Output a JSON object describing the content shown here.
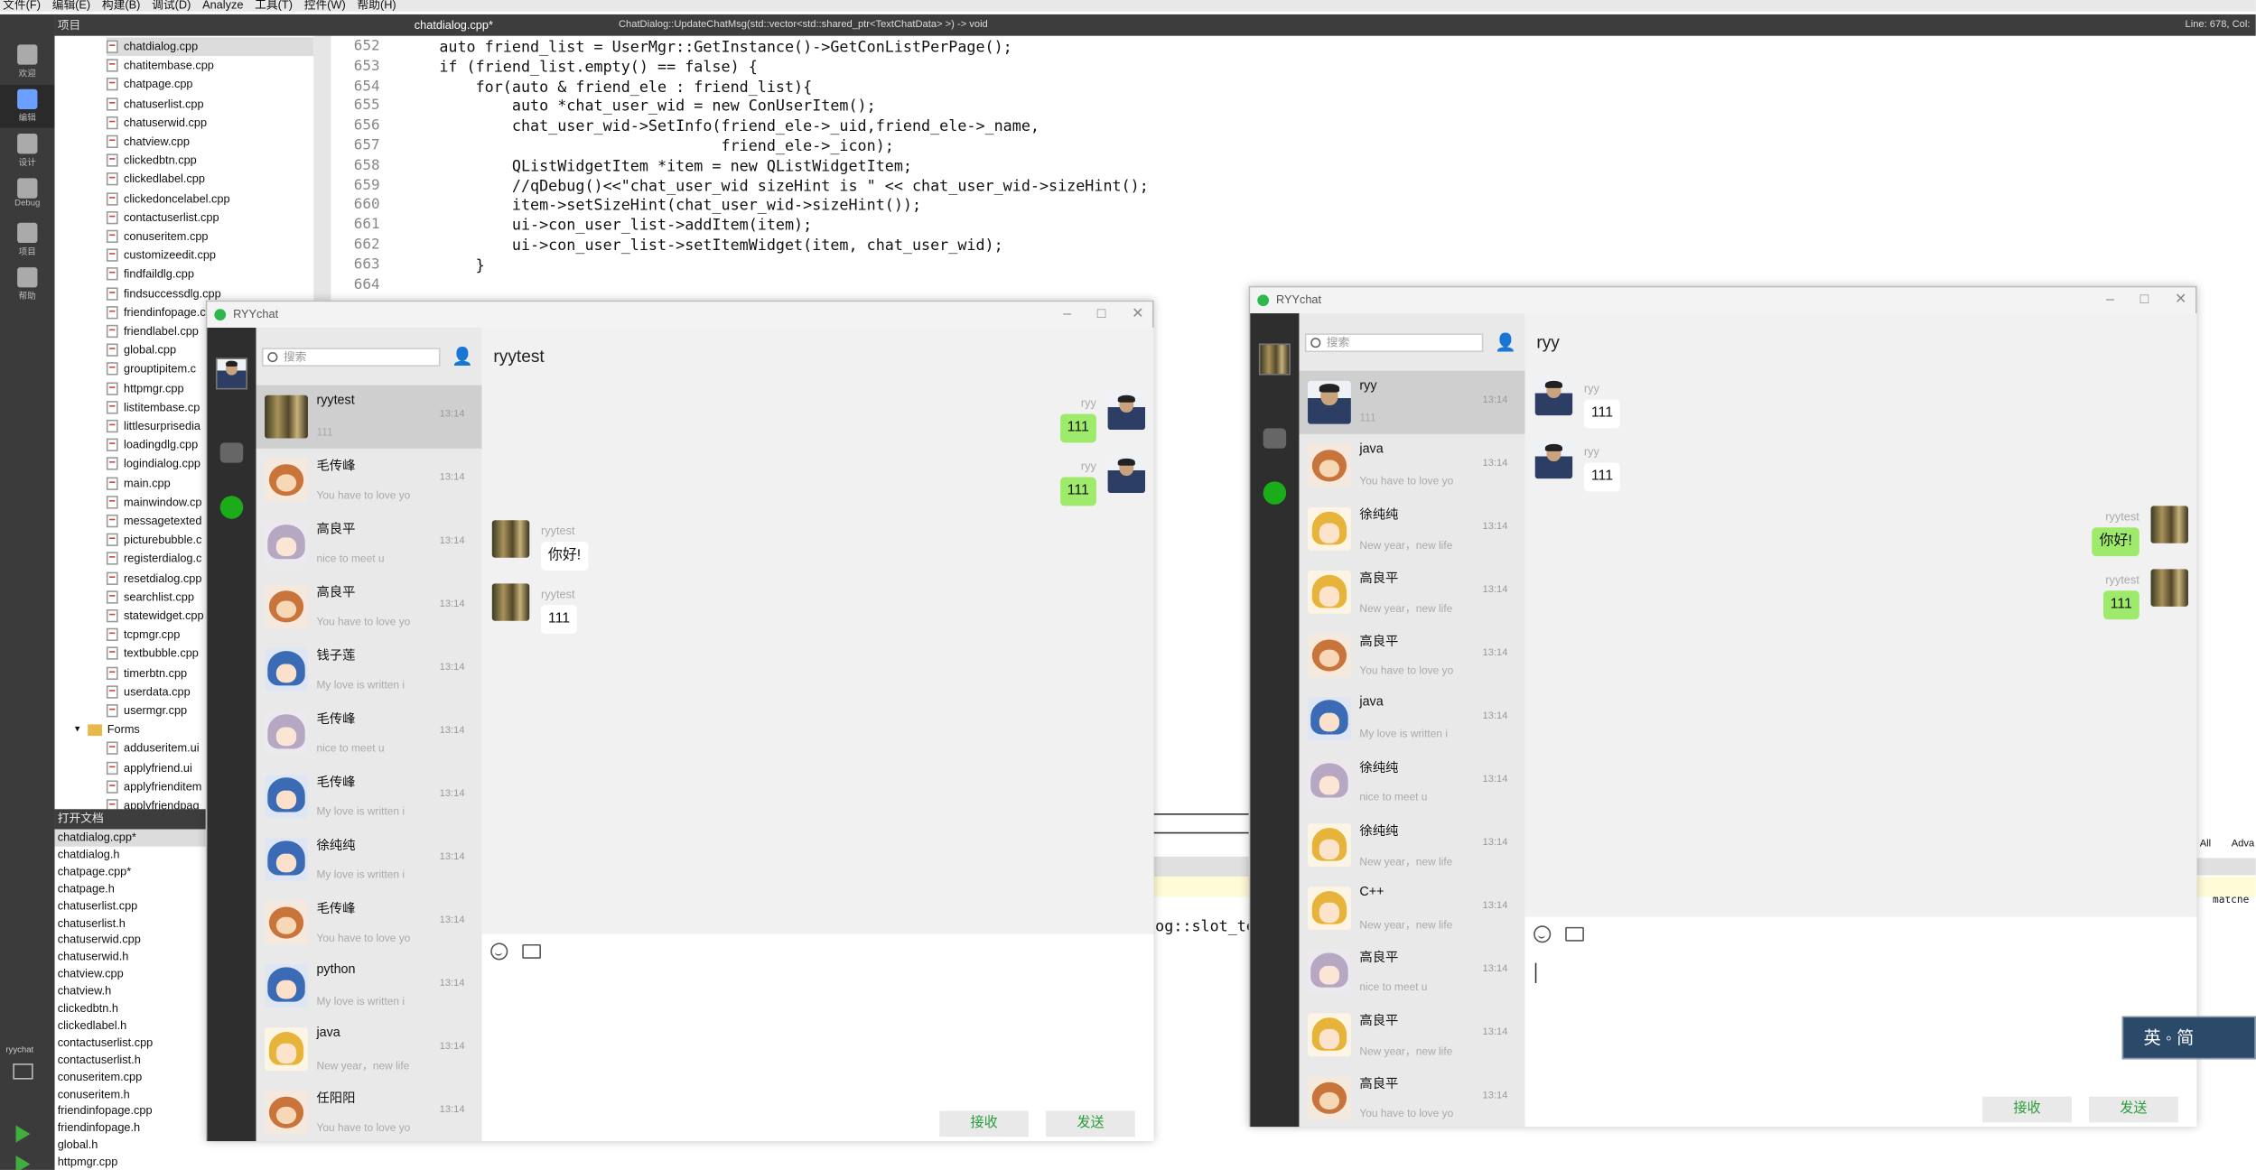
{
  "ide": {
    "menu": [
      "文件(F)",
      "编辑(E)",
      "构建(B)",
      "调试(D)",
      "Analyze",
      "工具(T)",
      "控件(W)",
      "帮助(H)"
    ],
    "project_label": "项目",
    "open_file": "chatdialog.cpp*",
    "function_sig": "ChatDialog::UpdateChatMsg(std::vector<std::shared_ptr<TextChatData> >) -> void",
    "line_info": "Line: 678, Col:",
    "modes": [
      "欢迎",
      "编辑",
      "设计",
      "Debug",
      "项目",
      "帮助"
    ],
    "tree_files": [
      "chatdialog.cpp",
      "chatitembase.cpp",
      "chatpage.cpp",
      "chatuserlist.cpp",
      "chatuserwid.cpp",
      "chatview.cpp",
      "clickedbtn.cpp",
      "clickedlabel.cpp",
      "clickedoncelabel.cpp",
      "contactuserlist.cpp",
      "conuseritem.cpp",
      "customizeedit.cpp",
      "findfaildlg.cpp",
      "findsuccessdlg.cpp",
      "friendinfopage.c",
      "friendlabel.cpp",
      "global.cpp",
      "grouptipitem.c",
      "httpmgr.cpp",
      "listitembase.cp",
      "littlesurprisedia",
      "loadingdlg.cpp",
      "logindialog.cpp",
      "main.cpp",
      "mainwindow.cp",
      "messagetexted",
      "picturebubble.c",
      "registerdialog.c",
      "resetdialog.cpp",
      "searchlist.cpp",
      "statewidget.cpp",
      "tcpmgr.cpp",
      "textbubble.cpp",
      "timerbtn.cpp",
      "userdata.cpp",
      "usermgr.cpp"
    ],
    "forms_label": "Forms",
    "form_files": [
      "adduseritem.ui",
      "applyfriend.ui",
      "applyfrienditem",
      "applyfriendpag"
    ],
    "open_docs_label": "打开文档",
    "open_docs": [
      "chatdialog.cpp*",
      "chatdialog.h",
      "chatpage.cpp*",
      "chatpage.h",
      "chatuserlist.cpp",
      "chatuserlist.h",
      "chatuserwid.cpp",
      "chatuserwid.h",
      "chatview.cpp",
      "chatview.h",
      "clickedbtn.h",
      "clickedlabel.h",
      "contactuserlist.cpp",
      "contactuserlist.h",
      "conuseritem.cpp",
      "conuseritem.h",
      "friendinfopage.cpp",
      "friendinfopage.h",
      "global.h",
      "httpmgr.cpp"
    ],
    "line_numbers": [
      "652",
      "653",
      "654",
      "655",
      "656",
      "657",
      "658",
      "659",
      "660",
      "661",
      "662",
      "663",
      "664"
    ],
    "code_lines": [
      "    auto friend_list = UserMgr::GetInstance()->GetConListPerPage();",
      "    if (friend_list.empty() == false) {",
      "        for(auto & friend_ele : friend_list){",
      "            auto *chat_user_wid = new ConUserItem();",
      "            chat_user_wid->SetInfo(friend_ele->_uid,friend_ele->_name,",
      "                                   friend_ele->_icon);",
      "            QListWidgetItem *item = new QListWidgetItem;",
      "            //qDebug()<<\"chat_user_wid sizeHint is \" << chat_user_wid->sizeHint();",
      "            item->setSizeHint(chat_user_wid->sizeHint());",
      "            ui->con_user_list->addItem(item);",
      "            ui->con_user_list->setItemWidget(item, chat_user_wid);",
      "        }",
      ""
    ],
    "partial_code": "og::slot_te",
    "right_stub_1": "All",
    "right_stub_2": "Adva",
    "right_stub_3": "3 matche",
    "target_label": "ryychat",
    "ime": "英 ◦ 简"
  },
  "win_left": {
    "title": "RYYchat",
    "search_placeholder": "搜索",
    "chat_title": "ryytest",
    "items": [
      {
        "name": "ryytest",
        "preview": "111",
        "time": "13:14",
        "av": "av-shelf"
      },
      {
        "name": "毛传峰",
        "preview": "You have to love yo",
        "time": "13:14",
        "av": "av-bear"
      },
      {
        "name": "高良平",
        "preview": "nice to meet u",
        "time": "13:14",
        "av": "av-gray"
      },
      {
        "name": "高良平",
        "preview": "You have to love yo",
        "time": "13:14",
        "av": "av-bear"
      },
      {
        "name": "钱子莲",
        "preview": "My love is written i",
        "time": "13:14",
        "av": "av-girl"
      },
      {
        "name": "毛传峰",
        "preview": "nice to meet u",
        "time": "13:14",
        "av": "av-gray"
      },
      {
        "name": "毛传峰",
        "preview": "My love is written i",
        "time": "13:14",
        "av": "av-girl"
      },
      {
        "name": "徐纯纯",
        "preview": "My love is written i",
        "time": "13:14",
        "av": "av-girl"
      },
      {
        "name": "毛传峰",
        "preview": "You have to love yo",
        "time": "13:14",
        "av": "av-bear"
      },
      {
        "name": "python",
        "preview": "My love is written i",
        "time": "13:14",
        "av": "av-girl"
      },
      {
        "name": "java",
        "preview": "New year，new life",
        "time": "13:14",
        "av": "av-crown"
      },
      {
        "name": "任阳阳",
        "preview": "You have to love yo",
        "time": "13:14",
        "av": "av-bear"
      }
    ],
    "messages": [
      {
        "side": "mine",
        "who": "ryy",
        "text": "111",
        "av": "av-photo"
      },
      {
        "side": "mine",
        "who": "ryy",
        "text": "111",
        "av": "av-photo"
      },
      {
        "side": "other",
        "who": "ryytest",
        "text": "你好!",
        "av": "av-shelf"
      },
      {
        "side": "other",
        "who": "ryytest",
        "text": "111",
        "av": "av-shelf"
      }
    ],
    "btn_receive": "接收",
    "btn_send": "发送"
  },
  "win_right": {
    "title": "RYYchat",
    "search_placeholder": "搜索",
    "chat_title": "ryy",
    "items": [
      {
        "name": "ryy",
        "preview": "111",
        "time": "13:14",
        "av": "av-photo"
      },
      {
        "name": "java",
        "preview": "You have to love yo",
        "time": "13:14",
        "av": "av-bear"
      },
      {
        "name": "徐纯纯",
        "preview": "New year，new life",
        "time": "13:14",
        "av": "av-crown"
      },
      {
        "name": "高良平",
        "preview": "New year，new life",
        "time": "13:14",
        "av": "av-crown"
      },
      {
        "name": "高良平",
        "preview": "You have to love yo",
        "time": "13:14",
        "av": "av-bear"
      },
      {
        "name": "java",
        "preview": "My love is written i",
        "time": "13:14",
        "av": "av-girl"
      },
      {
        "name": "徐纯纯",
        "preview": "nice to meet u",
        "time": "13:14",
        "av": "av-gray"
      },
      {
        "name": "徐纯纯",
        "preview": "New year，new life",
        "time": "13:14",
        "av": "av-crown"
      },
      {
        "name": "C++",
        "preview": "New year，new life",
        "time": "13:14",
        "av": "av-crown"
      },
      {
        "name": "高良平",
        "preview": "nice to meet u",
        "time": "13:14",
        "av": "av-gray"
      },
      {
        "name": "高良平",
        "preview": "New year，new life",
        "time": "13:14",
        "av": "av-crown"
      },
      {
        "name": "高良平",
        "preview": "You have to love yo",
        "time": "13:14",
        "av": "av-bear"
      }
    ],
    "messages": [
      {
        "side": "other",
        "who": "ryy",
        "text": "111",
        "av": "av-photo"
      },
      {
        "side": "other",
        "who": "ryy",
        "text": "111",
        "av": "av-photo"
      },
      {
        "side": "mine",
        "who": "ryytest",
        "text": "你好!",
        "av": "av-shelf"
      },
      {
        "side": "mine",
        "who": "ryytest",
        "text": "111",
        "av": "av-shelf"
      }
    ],
    "btn_receive": "接收",
    "btn_send": "发送"
  },
  "colors": {
    "accent_green": "#1aad19",
    "bubble_mine": "#9eea6a",
    "sidebar_dark": "#2e2e2e",
    "list_bg": "#e9e9e9"
  }
}
